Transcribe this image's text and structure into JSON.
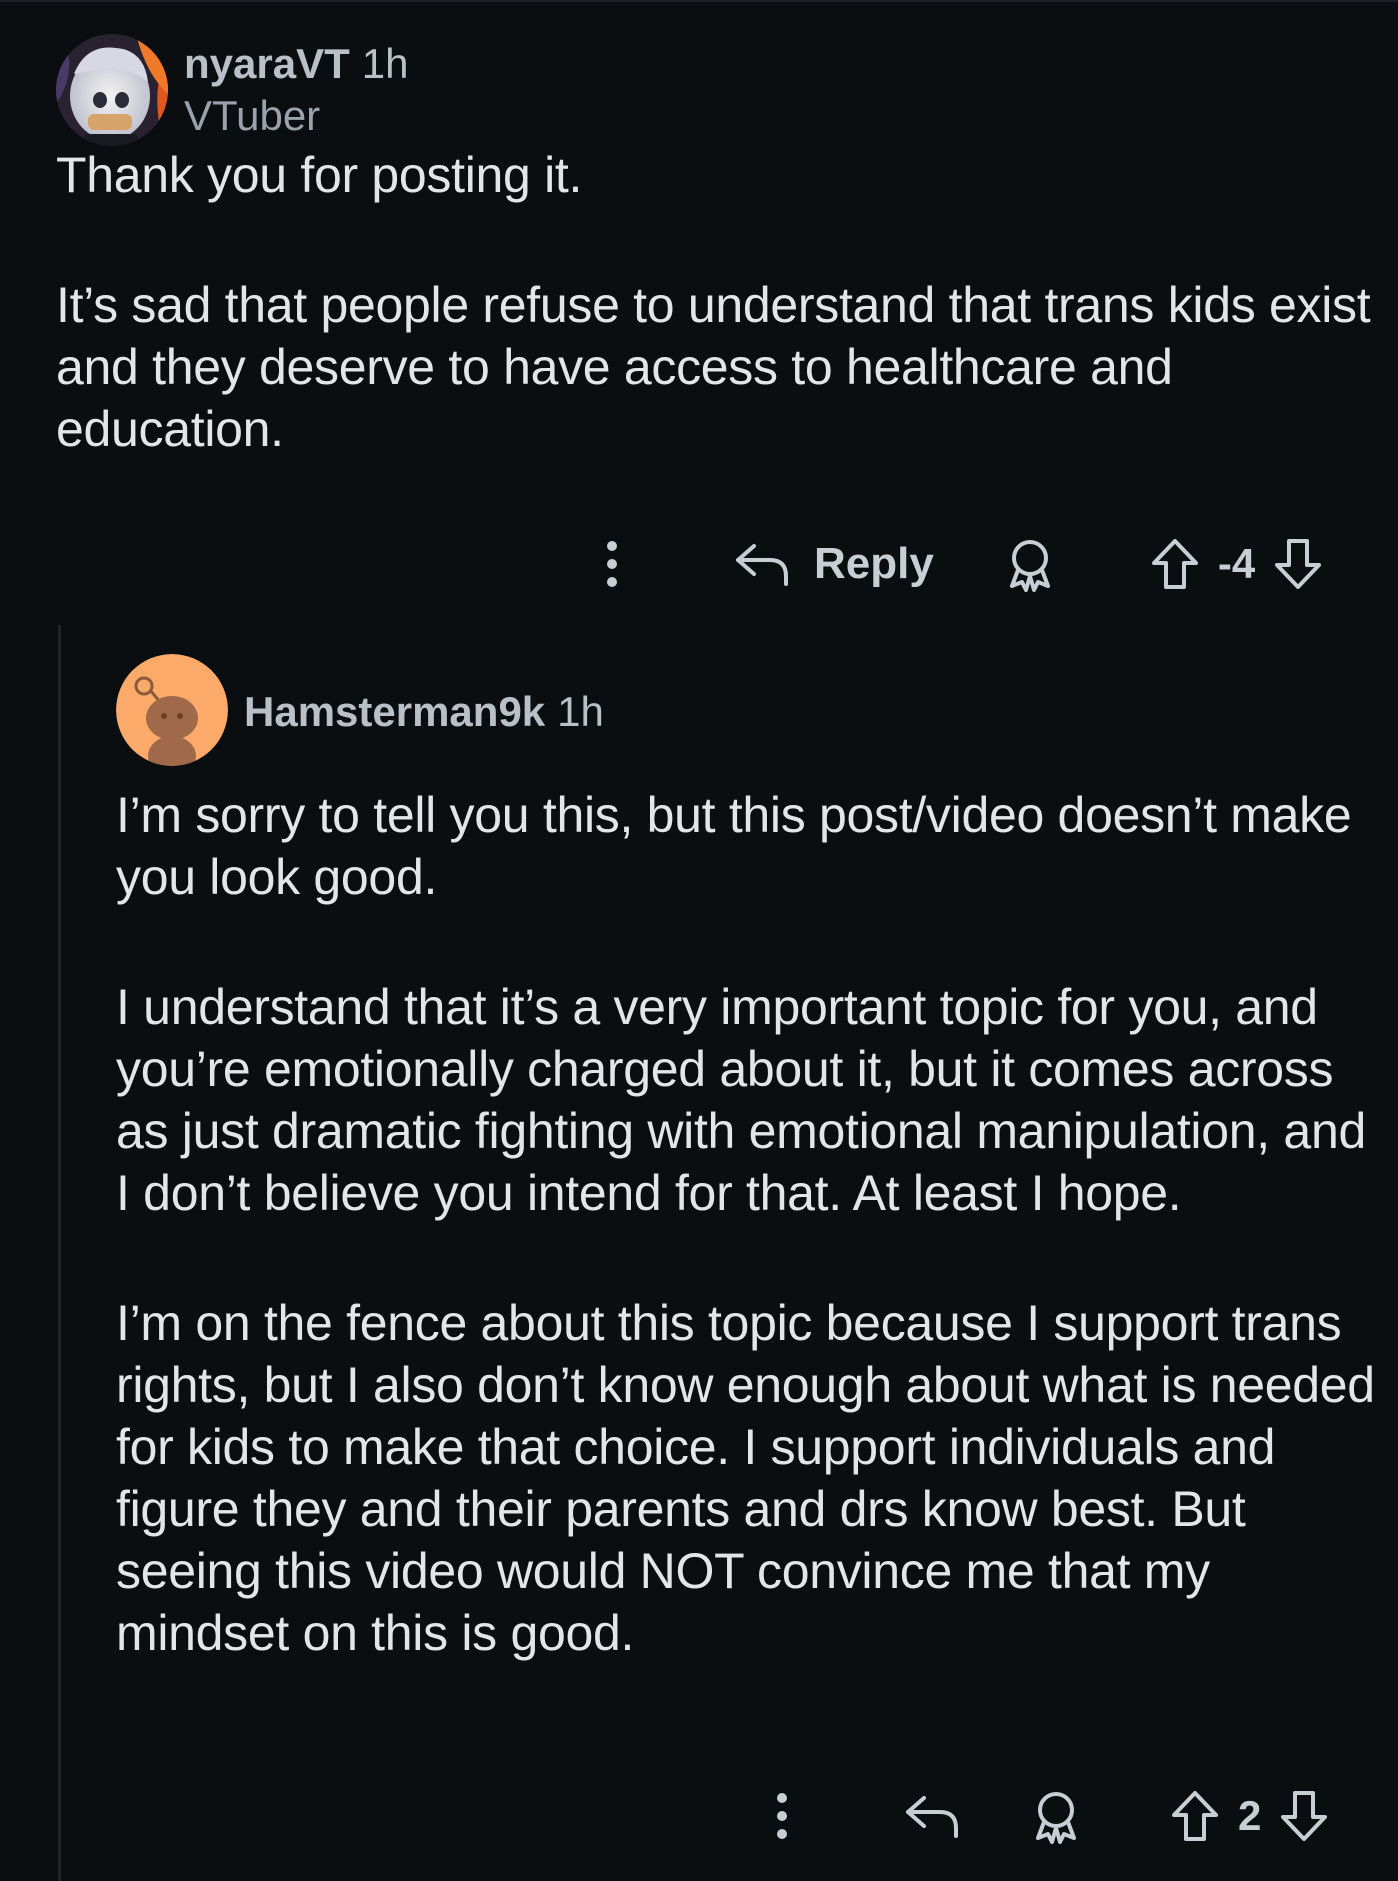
{
  "comments": [
    {
      "username": "nyaraVT",
      "time": "1h",
      "flair": "VTuber",
      "paragraphs": [
        "Thank you for posting it.",
        "It’s sad that people refuse to understand that trans kids exist and they deserve to have access to healthcare and education."
      ],
      "actions": {
        "more_icon": "vertical-dots-icon",
        "reply_icon": "reply-arrow-icon",
        "reply_label": "Reply",
        "award_icon": "award-icon",
        "upvote_icon": "upvote-arrow-icon",
        "score": "-4",
        "downvote_icon": "downvote-arrow-icon"
      }
    },
    {
      "username": "Hamsterman9k",
      "time": "1h",
      "paragraphs": [
        "I’m sorry to tell you this, but this post/video doesn’t make you look good.",
        "I understand that it’s a very important topic for you, and you’re emotionally charged about it, but it comes across as just dramatic fighting with emotional manipulation, and I don’t believe you intend for that. At least I hope.",
        "I’m on the fence about this topic because I support trans rights, but I also don’t know enough about what is needed for kids to make that choice. I support individuals and figure they and their parents and drs know best. But seeing this video would NOT convince me that my mindset on this is good."
      ],
      "actions": {
        "more_icon": "vertical-dots-icon",
        "reply_icon": "reply-arrow-icon",
        "award_icon": "award-icon",
        "upvote_icon": "upvote-arrow-icon",
        "score": "2",
        "downvote_icon": "downvote-arrow-icon"
      }
    }
  ],
  "colors": {
    "background": "#0b0e11",
    "text": "#e3e6e8",
    "meta": "#b9c0c8",
    "avatar_orange": "#fcaa6a"
  }
}
